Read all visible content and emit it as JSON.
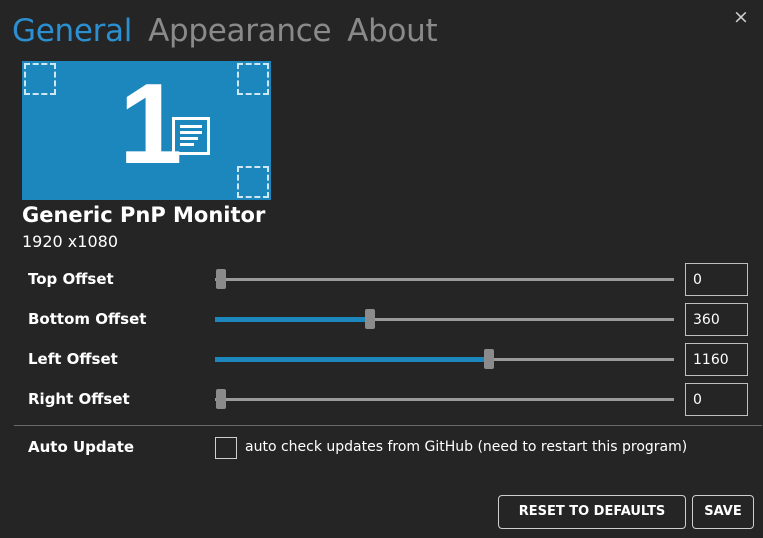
{
  "tabs": [
    {
      "label": "General",
      "active": true
    },
    {
      "label": "Appearance",
      "active": false
    },
    {
      "label": "About",
      "active": false
    }
  ],
  "close_icon": "×",
  "monitor": {
    "number": "1",
    "name": "Generic PnP Monitor",
    "resolution": "1920 x1080",
    "preview_color": "#1b87bd"
  },
  "offsets": [
    {
      "label": "Top Offset",
      "value": "0",
      "level_fraction": 0.0
    },
    {
      "label": "Bottom Offset",
      "value": "360",
      "level_fraction": 0.338
    },
    {
      "label": "Left Offset",
      "value": "1160",
      "level_fraction": 0.597
    },
    {
      "label": "Right Offset",
      "value": "0",
      "level_fraction": 0.0
    }
  ],
  "auto_update": {
    "label": "Auto Update",
    "checkbox_text": "auto check updates from GitHub (need to restart this program)",
    "checked": false
  },
  "buttons": {
    "reset": "RESET TO DEFAULTS",
    "save": "SAVE"
  },
  "colors": {
    "accent": "#2b8fd0",
    "background": "#252525",
    "inactive_tab": "#8a8a8a"
  }
}
